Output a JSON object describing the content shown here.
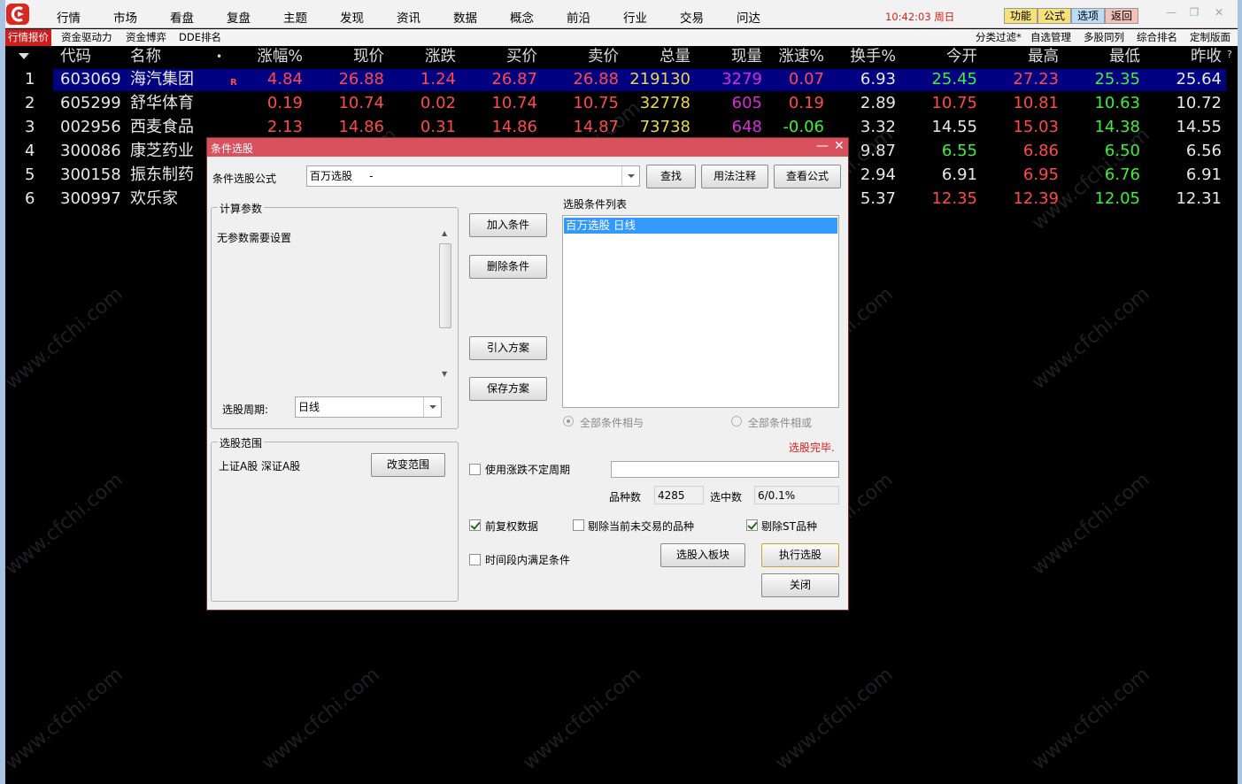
{
  "menubar": {
    "items": [
      "行情",
      "市场",
      "看盘",
      "复盘",
      "主题",
      "发现",
      "资讯",
      "数据",
      "概念",
      "前沿",
      "行业",
      "交易",
      "问达"
    ],
    "clock": "10:42:03 周日",
    "buttons": [
      {
        "label": "功能",
        "color": "#f7e27a"
      },
      {
        "label": "公式",
        "color": "#f7e27a"
      },
      {
        "label": "选项",
        "color": "#b9dcf7"
      },
      {
        "label": "返回",
        "color": "#f2c2b8"
      }
    ]
  },
  "tabbar": {
    "left_tabs": [
      "行情报价",
      "资金驱动力",
      "资金博弈",
      "DDE排名"
    ],
    "right_tabs": [
      "分类过滤*",
      "自选管理",
      "多股同列",
      "综合排名",
      "定制版面"
    ]
  },
  "table": {
    "headers": [
      "代码",
      "名称",
      "•",
      "涨幅%",
      "现价",
      "涨跌",
      "买价",
      "卖价",
      "总量",
      "现量",
      "涨速%",
      "换手%",
      "今开",
      "最高",
      "最低",
      "昨收"
    ],
    "help_mark": "?",
    "rows": [
      {
        "idx": "1",
        "code": "603069",
        "name": "海汽集团",
        "flag": "R",
        "chg_pct": "4.84",
        "price": "26.88",
        "chg": "1.24",
        "bid": "26.87",
        "ask": "26.88",
        "vol": "219130",
        "cur_vol": "3279",
        "speed": "0.07",
        "turnover": "6.93",
        "open": "25.45",
        "high": "27.23",
        "low": "25.35",
        "prev": "25.64"
      },
      {
        "idx": "2",
        "code": "605299",
        "name": "舒华体育",
        "flag": "",
        "chg_pct": "0.19",
        "price": "10.74",
        "chg": "0.02",
        "bid": "10.74",
        "ask": "10.75",
        "vol": "32778",
        "cur_vol": "605",
        "speed": "0.19",
        "turnover": "2.89",
        "open": "10.75",
        "high": "10.81",
        "low": "10.63",
        "prev": "10.72"
      },
      {
        "idx": "3",
        "code": "002956",
        "name": "西麦食品",
        "flag": "",
        "chg_pct": "2.13",
        "price": "14.86",
        "chg": "0.31",
        "bid": "14.86",
        "ask": "14.87",
        "vol": "73738",
        "cur_vol": "648",
        "speed": "-0.06",
        "turnover": "3.32",
        "open": "14.55",
        "high": "15.03",
        "low": "14.38",
        "prev": "14.55"
      },
      {
        "idx": "4",
        "code": "300086",
        "name": "康芝药业",
        "flag": "",
        "chg_pct": "",
        "price": "",
        "chg": "",
        "bid": "",
        "ask": "",
        "vol": "",
        "cur_vol": "",
        "speed": "",
        "turnover": "9.87",
        "open": "6.55",
        "high": "6.86",
        "low": "6.50",
        "prev": "6.56"
      },
      {
        "idx": "5",
        "code": "300158",
        "name": "振东制药",
        "flag": "",
        "chg_pct": "",
        "price": "",
        "chg": "",
        "bid": "",
        "ask": "",
        "vol": "",
        "cur_vol": "",
        "speed": "",
        "turnover": "2.94",
        "open": "6.91",
        "high": "6.95",
        "low": "6.76",
        "prev": "6.91"
      },
      {
        "idx": "6",
        "code": "300997",
        "name": "欢乐家",
        "flag": "",
        "chg_pct": "",
        "price": "",
        "chg": "",
        "bid": "",
        "ask": "",
        "vol": "",
        "cur_vol": "",
        "speed": "",
        "turnover": "5.37",
        "open": "12.35",
        "high": "12.39",
        "low": "12.05",
        "prev": "12.31"
      }
    ]
  },
  "watermark": "www.cfchi.com",
  "dialog": {
    "title": "条件选股",
    "formula_label": "条件选股公式",
    "formula_value": "百万选股     -",
    "find_button": "查找",
    "usage_button": "用法注释",
    "view_formula_button": "查看公式",
    "params_group": "计算参数",
    "params_text": "无参数需要设置",
    "period_label": "选股周期:",
    "period_value": "日线",
    "scope_group": "选股范围",
    "scope_text": "上证A股 深证A股",
    "change_scope_button": "改变范围",
    "add_button": "加入条件",
    "delete_button": "删除条件",
    "import_button": "引入方案",
    "save_button": "保存方案",
    "list_label": "选股条件列表",
    "list_items": [
      "百万选股  日线"
    ],
    "radio_and": "全部条件相与",
    "radio_or": "全部条件相或",
    "status": "选股完毕.",
    "irregular_period_label": "使用涨跌不定周期",
    "count_label": "品种数",
    "count_value": "4285",
    "selected_label": "选中数",
    "selected_value": "6/0.1%",
    "adjust_label": "前复权数据",
    "exclude_untraded_label": "剔除当前未交易的品种",
    "exclude_st_label": "剔除ST品种",
    "time_range_label": "时间段内满足条件",
    "to_block_button": "选股入板块",
    "execute_button": "执行选股",
    "close_button": "关闭"
  },
  "colors": {
    "up": "#ff4a4a",
    "down": "#3cf03c",
    "white": "#e8e8e8",
    "volume": "#e8d84a",
    "current_volume": "#d62cd6",
    "selected_row": "#000080",
    "title_bar": "#d7525d"
  }
}
